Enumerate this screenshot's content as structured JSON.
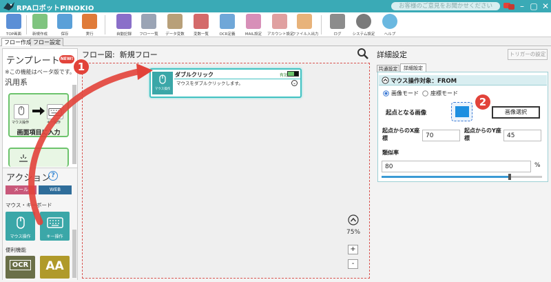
{
  "app": {
    "title": "RPAロボットPINOKIO",
    "feedback": "お客様のご意見をお聞かせください"
  },
  "toolbar": [
    {
      "label": "TOP画面",
      "color": "#5b8fd6"
    },
    {
      "label": "新規作成",
      "color": "#7fc47f"
    },
    {
      "label": "保存",
      "color": "#5aa0d8"
    },
    {
      "label": "実行",
      "color": "#e07b39"
    },
    {
      "label": "自動記録",
      "color": "#8a6fc9"
    },
    {
      "label": "フロー一覧",
      "color": "#9aa4b5"
    },
    {
      "label": "データ変数",
      "color": "#b8a079"
    },
    {
      "label": "変数一覧",
      "color": "#d46a6a"
    },
    {
      "label": "OCR定義",
      "color": "#6fa7d8"
    },
    {
      "label": "MAIL設定",
      "color": "#d78fb8"
    },
    {
      "label": "アカウント設定",
      "color": "#e0a0a0"
    },
    {
      "label": "ファイル入出力",
      "color": "#e8b37a"
    },
    {
      "label": "ログ",
      "color": "#8c8c8c"
    },
    {
      "label": "システム設定",
      "color": "#7a7a7a"
    },
    {
      "label": "ヘルプ",
      "color": "#6ab8e0"
    }
  ],
  "tabs": [
    "フロー作成",
    "フロー設定"
  ],
  "left": {
    "template_title": "テンプレート",
    "new_badge": "NEW!",
    "beta_note": "※この機能はベータ版です。",
    "category": "汎用系",
    "template_card": {
      "label": "画面項目に入力",
      "mouse": "マウス操作",
      "key": "キー操作"
    },
    "action_title": "アクション",
    "help": "?",
    "tab_mail": "メール",
    "tab_web": "WEB",
    "section_mouse_key": "マウス・キーボード",
    "tile_mouse": "マウス操作",
    "tile_key": "キー操作",
    "section_util": "便利機能",
    "tile_ocr": "OCR",
    "tile_aa": "AA"
  },
  "center": {
    "flow_title": "フロー図:  新規フロー",
    "node": {
      "title": "ダブルクリック",
      "status": "有効",
      "desc": "マウスをダブルクリックします。",
      "icon_label": "マウス操作"
    },
    "zoom": "75%",
    "plus": "+",
    "minus": "-"
  },
  "right": {
    "title": "詳細設定",
    "trigger_button": "トリガーの設定",
    "tab_common": "共通設定",
    "tab_detail": "詳細設定",
    "section": "マウス操作対象：FROM",
    "radio_image": "画像モード",
    "radio_coord": "座標モード",
    "origin_label": "起点となる画像",
    "select_image": "画像選択",
    "x_label": "起点からのX座標",
    "x_value": "70",
    "y_label": "起点からのY座標",
    "y_value": "45",
    "similarity_label": "類似率",
    "similarity_value": "80",
    "percent": "%",
    "slider_value": 0.8
  },
  "badges": {
    "one": "1",
    "two": "2"
  },
  "colors": {
    "teal": "#3aaab6",
    "red": "#e2433a",
    "green": "#6cc36c"
  }
}
